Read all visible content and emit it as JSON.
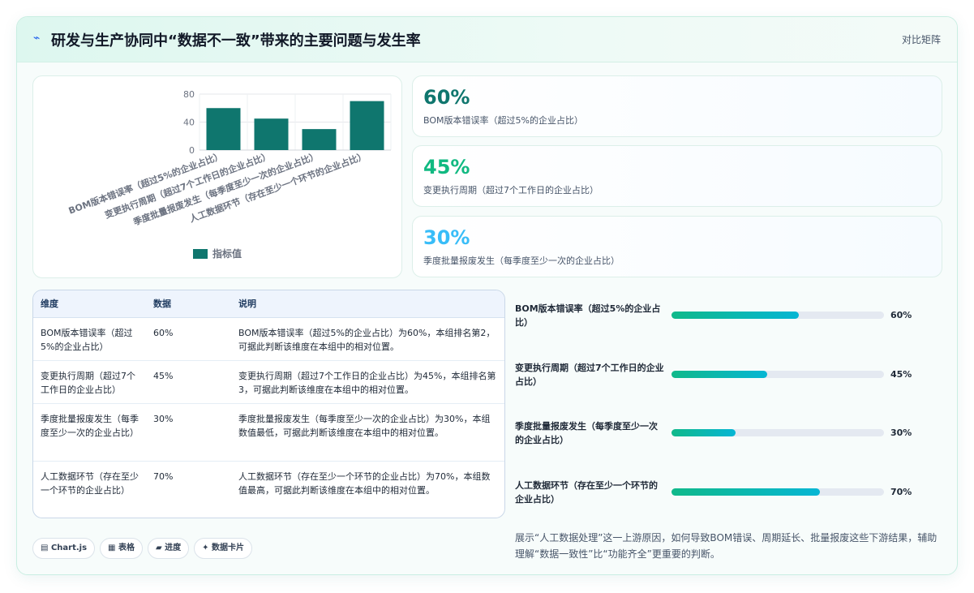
{
  "header": {
    "icon": "bolt-icon",
    "title": "研发与生产协同中“数据不一致”带来的主要问题与发生率",
    "tag": "对比矩阵"
  },
  "chart_data": {
    "type": "bar",
    "categories": [
      "BOM版本错误率（超过5%的企业占比）",
      "变更执行周期（超过7个工作日的企业占比）",
      "季度批量报废发生（每季度至少一次的企业占比）",
      "人工数据环节（存在至少一个环节的企业占比）"
    ],
    "series": [
      {
        "name": "指标值",
        "values": [
          60,
          45,
          30,
          70
        ]
      }
    ],
    "yticks": [
      "0",
      "40",
      "80"
    ],
    "ylim": [
      0,
      80
    ],
    "grid": true,
    "legend": "bottom",
    "color": "#0f766e"
  },
  "kpis": [
    {
      "value": "60%",
      "label": "BOM版本错误率（超过5%的企业占比）",
      "color": "#0f766e"
    },
    {
      "value": "45%",
      "label": "变更执行周期（超过7个工作日的企业占比）",
      "color": "#10b981"
    },
    {
      "value": "30%",
      "label": "季度批量报废发生（每季度至少一次的企业占比）",
      "color": "#38bdf8"
    }
  ],
  "table": {
    "headers": [
      "维度",
      "数据",
      "说明"
    ],
    "rows": [
      {
        "dim": "BOM版本错误率（超过5%的企业占比）",
        "value": "60%",
        "desc": "BOM版本错误率（超过5%的企业占比）为60%，本组排名第2，可据此判断该维度在本组中的相对位置。"
      },
      {
        "dim": "变更执行周期（超过7个工作日的企业占比）",
        "value": "45%",
        "desc": "变更执行周期（超过7个工作日的企业占比）为45%，本组排名第3，可据此判断该维度在本组中的相对位置。"
      },
      {
        "dim": "季度批量报废发生（每季度至少一次的企业占比）",
        "value": "30%",
        "desc": "季度批量报废发生（每季度至少一次的企业占比）为30%，本组数值最低，可据此判断该维度在本组中的相对位置。"
      },
      {
        "dim": "人工数据环节（存在至少一个环节的企业占比）",
        "value": "70%",
        "desc": "人工数据环节（存在至少一个环节的企业占比）为70%，本组数值最高，可据此判断该维度在本组中的相对位置。"
      }
    ]
  },
  "progress": [
    {
      "label": "BOM版本错误率（超过5%的企业占比）",
      "value": "60%",
      "fraction": 0.6
    },
    {
      "label": "变更执行周期（超过7个工作日的企业占比）",
      "value": "45%",
      "fraction": 0.45
    },
    {
      "label": "季度批量报废发生（每季度至少一次的企业占比）",
      "value": "30%",
      "fraction": 0.3
    },
    {
      "label": "人工数据环节（存在至少一个环节的企业占比）",
      "value": "70%",
      "fraction": 0.7
    }
  ],
  "chips": [
    {
      "icon": "chart-icon",
      "glyph": "▤",
      "label": "Chart.js"
    },
    {
      "icon": "table-icon",
      "glyph": "▦",
      "label": "表格"
    },
    {
      "icon": "folder-icon",
      "glyph": "▰",
      "label": "进度"
    },
    {
      "icon": "sparkle-icon",
      "glyph": "✦",
      "label": "数据卡片"
    }
  ],
  "note": "展示“人工数据处理”这一上游原因，如何导致BOM错误、周期延长、批量报废这些下游结果，辅助理解“数据一致性”比“功能齐全”更重要的判断。"
}
